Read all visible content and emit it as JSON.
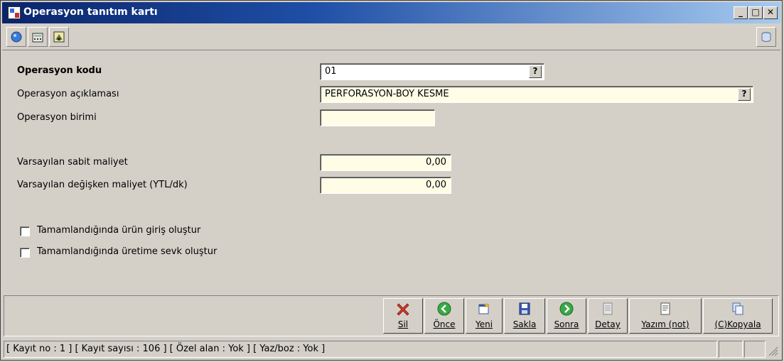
{
  "window": {
    "title": "Operasyon tanıtım kartı"
  },
  "window_controls": {
    "minimize": "_",
    "maximize": "□",
    "close": "✕"
  },
  "toolbar": {
    "icons": [
      "help-icon",
      "calculator-icon",
      "settings-icon"
    ],
    "right_icon": "database-icon"
  },
  "form": {
    "code": {
      "label": "Operasyon kodu",
      "value": "01",
      "lookup": "?"
    },
    "description": {
      "label": "Operasyon açıklaması",
      "value": "PERFORASYON-BOY KESME",
      "lookup": "?"
    },
    "unit": {
      "label": "Operasyon birimi",
      "value": ""
    },
    "fixed_cost": {
      "label": "Varsayılan sabit maliyet",
      "value": "0,00"
    },
    "variable_cost": {
      "label": "Varsayılan değişken maliyet (YTL/dk)",
      "value": "0,00"
    },
    "checkbox_product_entry": {
      "label": "Tamamlandığında ürün giriş oluştur",
      "checked": false
    },
    "checkbox_production_dispatch": {
      "label": "Tamamlandığında üretime sevk oluştur",
      "checked": false
    }
  },
  "actions": {
    "delete": "Sil",
    "previous": "Önce",
    "new": "Yeni",
    "save": "Sakla",
    "next": "Sonra",
    "detail": "Detay",
    "print": "Yazım (not)",
    "copy": "(C)Kopyala"
  },
  "status": {
    "text": "[ Kayıt no : 1 ] [ Kayıt sayısı : 106 ] [ Özel alan : Yok ] [ Yaz/boz : Yok ]"
  },
  "colors": {
    "titlebar_start": "#0a246a",
    "titlebar_end": "#a6caf0",
    "field_bg": "#fffde6",
    "face": "#d4d0c8"
  }
}
